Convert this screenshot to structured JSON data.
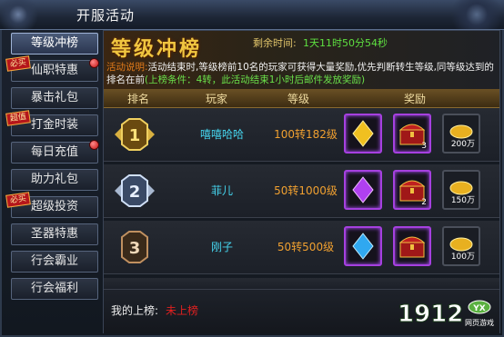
{
  "window": {
    "title": "开服活动"
  },
  "sidebar": {
    "items": [
      {
        "label": "等级冲榜",
        "active": true,
        "tag": "",
        "dot": false
      },
      {
        "label": "仙职特惠",
        "active": false,
        "tag": "必买",
        "dot": true
      },
      {
        "label": "暴击礼包",
        "active": false,
        "tag": "",
        "dot": false
      },
      {
        "label": "打金时装",
        "active": false,
        "tag": "超值",
        "dot": false
      },
      {
        "label": "每日充值",
        "active": false,
        "tag": "",
        "dot": true
      },
      {
        "label": "助力礼包",
        "active": false,
        "tag": "",
        "dot": false
      },
      {
        "label": "超级投资",
        "active": false,
        "tag": "必买",
        "dot": false
      },
      {
        "label": "圣器特惠",
        "active": false,
        "tag": "",
        "dot": false
      },
      {
        "label": "行会霸业",
        "active": false,
        "tag": "",
        "dot": false
      },
      {
        "label": "行会福利",
        "active": false,
        "tag": "",
        "dot": false
      }
    ]
  },
  "banner": {
    "title": "等级冲榜",
    "countdown_label": "剩余时间:",
    "countdown_value": "1天11时50分54秒",
    "desc_label": "活动说明:",
    "desc_text": "活动结束时,等级榜前10名的玩家可获得大量奖励,优先判断转生等级,同等级达到的排名在前",
    "desc_condition": "(上榜条件：4转，此活动结束1小时后邮件发放奖励)"
  },
  "table": {
    "headers": {
      "rank": "排名",
      "player": "玩家",
      "level": "等级",
      "reward": "奖励"
    },
    "rows": [
      {
        "rank": "1",
        "player": "嘻嘻哈哈",
        "level": "100转182级",
        "chest_qty": "3",
        "gold": "200万",
        "gem_color": "#f0c020"
      },
      {
        "rank": "2",
        "player": "菲儿",
        "level": "50转1000级",
        "chest_qty": "2",
        "gold": "150万",
        "gem_color": "#b040f0"
      },
      {
        "rank": "3",
        "player": "刚子",
        "level": "50转500级",
        "chest_qty": "",
        "gold": "100万",
        "gem_color": "#30a8f0"
      }
    ]
  },
  "footer": {
    "label": "我的上榜:",
    "value": "未上榜"
  },
  "logo": {
    "number": "1912",
    "badge": "YX",
    "sub": "网页游戏"
  },
  "colors": {
    "accent": "#f0c640",
    "player": "#46d6f0",
    "level": "#f0a030",
    "countdown": "#5ee040"
  }
}
